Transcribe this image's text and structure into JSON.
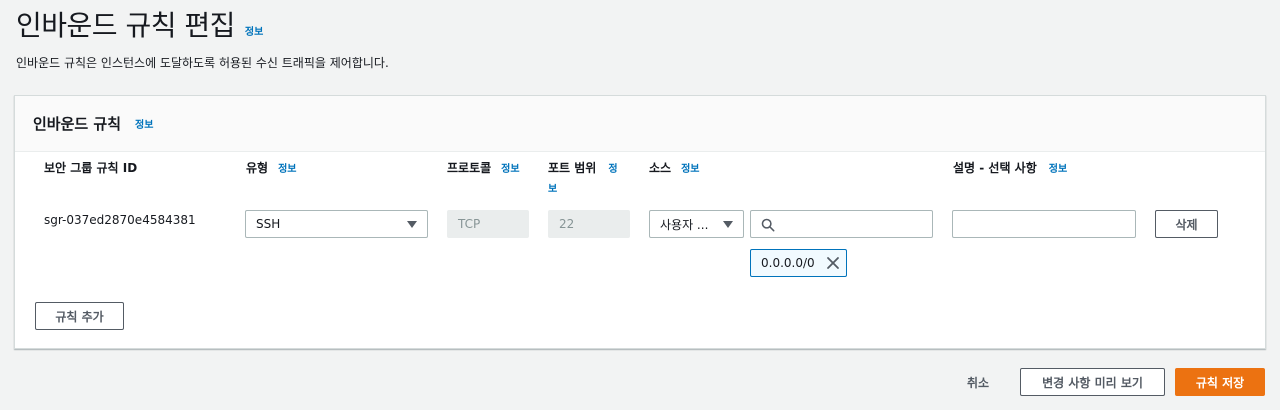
{
  "header": {
    "title": "인바운드 규칙 편집",
    "info": "정보",
    "description": "인바운드 규칙은 인스턴스에 도달하도록 허용된 수신 트래픽을 제어합니다."
  },
  "panel": {
    "title": "인바운드 규칙",
    "info": "정보",
    "columns": {
      "rule_id": "보안 그룹 규칙 ID",
      "type": "유형",
      "protocol": "프로토콜",
      "port_range": "포트 범위",
      "source": "소스",
      "description": "설명 - 선택 사항"
    },
    "row": {
      "rule_id": "sgr-037ed2870e4584381",
      "type": "SSH",
      "protocol": "TCP",
      "port_range": "22",
      "source_type": "사용자 ...",
      "source_search_value": "",
      "source_token": "0.0.0.0/0",
      "description_value": "",
      "delete_label": "삭제"
    },
    "add_rule_label": "규칙 추가"
  },
  "footer": {
    "cancel_label": "취소",
    "preview_label": "변경 사항 미리 보기",
    "save_label": "규칙 저장"
  },
  "icons": {
    "search": "search-icon",
    "close": "close-icon",
    "caret": "caret-down-icon"
  },
  "colors": {
    "primary": "#ec7211",
    "link": "#0073bb",
    "background": "#f2f3f3"
  }
}
